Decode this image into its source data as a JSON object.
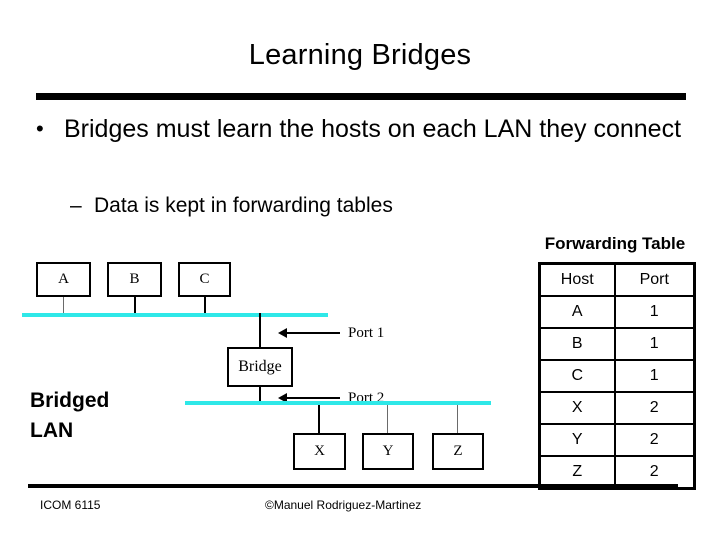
{
  "slide": {
    "title": "Learning Bridges",
    "bullets": [
      {
        "glyph": "•",
        "text": "Bridges must learn the hosts on each LAN they connect"
      }
    ],
    "subbullets": [
      {
        "glyph": "–",
        "text": "Data is kept in forwarding tables"
      }
    ]
  },
  "diagram": {
    "label": "Bridged\nLAN",
    "label_line1": "Bridged",
    "label_line2": "LAN",
    "bridge_label": "Bridge",
    "lan_color": "#2ee8e8",
    "top_hosts": [
      {
        "name": "A"
      },
      {
        "name": "B"
      },
      {
        "name": "C"
      }
    ],
    "bottom_hosts": [
      {
        "name": "X"
      },
      {
        "name": "Y"
      },
      {
        "name": "Z"
      }
    ],
    "ports": [
      {
        "label": "Port 1"
      },
      {
        "label": "Port 2"
      }
    ]
  },
  "forwarding_table": {
    "title": "Forwarding Table",
    "columns": [
      "Host",
      "Port"
    ],
    "rows": [
      {
        "host": "A",
        "port": "1"
      },
      {
        "host": "B",
        "port": "1"
      },
      {
        "host": "C",
        "port": "1"
      },
      {
        "host": "X",
        "port": "2"
      },
      {
        "host": "Y",
        "port": "2"
      },
      {
        "host": "Z",
        "port": "2"
      }
    ]
  },
  "footer": {
    "course": "ICOM 6115",
    "copyright": "©Manuel Rodriguez-Martinez"
  }
}
